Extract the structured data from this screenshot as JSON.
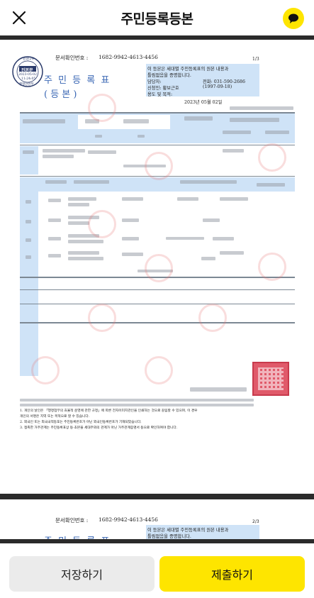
{
  "header": {
    "title": "주민등록등본",
    "close_icon": "close-icon",
    "chat_icon": "chat-bubble-icon"
  },
  "page1": {
    "serial_label": "문서확인번호 :",
    "serial_number": "1682-9942-4613-4456",
    "page_indicator": "1/3",
    "stamp_top": "민원24",
    "stamp_mid": "진본문",
    "stamp_date": "2023-05-02",
    "stamp_time": "11:24:05",
    "stamp_bottom": "행정안전부",
    "doc_title": "주 민 등 록 표",
    "doc_subtitle": "( 등    본 )",
    "notice_line1": "이 등본은 세대별 주민등록표의 원본 내용과",
    "notice_line2": "틀림없음을 증명합니다.",
    "contact_label": "담당자:",
    "contact_phone": "전화: 031-590-2686",
    "issuer_label": "신청인: 황보근호",
    "issuer_date": "(1997-09-18)",
    "purpose_label": "용도 및 목적:",
    "issue_date": "2023년 05월 02일"
  },
  "page2": {
    "serial_label": "문서확인번호 :",
    "serial_number": "1682-9942-4613-4456",
    "page_indicator": "2/3",
    "notice_line1": "이 등본은 세대별 주민등록표의 원본 내용과",
    "notice_line2": "틀림없음을 증명합니다.",
    "doc_title": "주 민 등 록 표"
  },
  "footer_notes": [
    "1. 개인의 날인은 「행정업무의 효율적 운영에 관한 규정」에 따른 전자이미지관인을 인쇄하는 것으로 갈음할 수 있으며, 이 경우",
    "   개인의 서명은 지역 또는 목적으로 할 수 있습니다.",
    "2. 외국인 또는 외국국적동포는 주민등록번호가 아닌 외국인등록번호가 기재되었습니다.",
    "3. 접촉한 거주관계는 주민등록표상 등·초본을 세대주와의 관계가 아닌 거주관계증명서 등으로 확인하여야 합니다."
  ],
  "buttons": {
    "save": "저장하기",
    "submit": "제출하기"
  },
  "colors": {
    "accent": "#fee500",
    "highlight": "#cfe3f7",
    "dark_bar": "#2b2b2b",
    "save_bg": "#ebebeb"
  }
}
